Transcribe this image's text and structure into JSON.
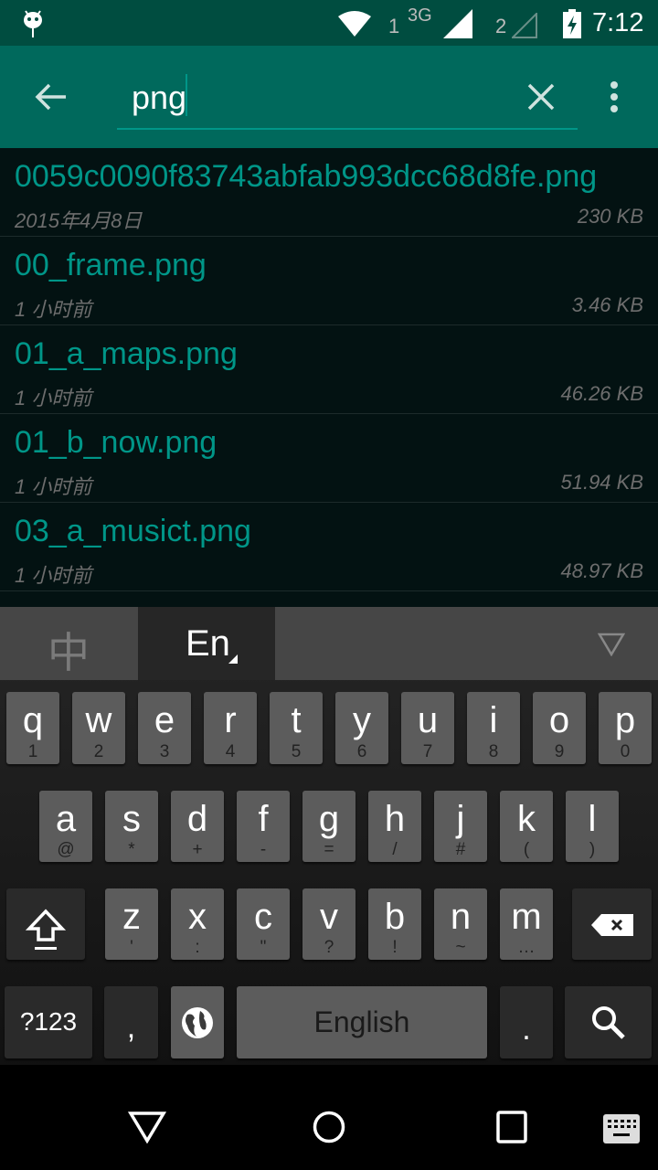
{
  "status_bar": {
    "time": "7:12",
    "sim1_label": "1",
    "network_type": "3G",
    "sim2_label": "2",
    "icons": [
      "android-icon",
      "wifi-icon",
      "signal-icon",
      "signal-empty-icon",
      "battery-charging-icon"
    ]
  },
  "search": {
    "query": "png",
    "back_icon": "arrow-left-icon",
    "clear_icon": "close-icon",
    "menu_icon": "more-vert-icon",
    "accent": "#009688"
  },
  "files": [
    {
      "name": "0059c0090f83743abfab993dcc68d8fe.png",
      "date": "2015年4月8日",
      "size": "230 KB"
    },
    {
      "name": "00_frame.png",
      "date": "1 小时前",
      "size": "3.46 KB"
    },
    {
      "name": "01_a_maps.png",
      "date": "1 小时前",
      "size": "46.26 KB"
    },
    {
      "name": "01_b_now.png",
      "date": "1 小时前",
      "size": "51.94 KB"
    },
    {
      "name": "03_a_musict.png",
      "date": "1 小时前",
      "size": "48.97 KB"
    }
  ],
  "keyboard": {
    "lang_tabs": {
      "chinese": "中",
      "english": "En"
    },
    "row1": [
      {
        "k": "q",
        "s": "1"
      },
      {
        "k": "w",
        "s": "2"
      },
      {
        "k": "e",
        "s": "3"
      },
      {
        "k": "r",
        "s": "4"
      },
      {
        "k": "t",
        "s": "5"
      },
      {
        "k": "y",
        "s": "6"
      },
      {
        "k": "u",
        "s": "7"
      },
      {
        "k": "i",
        "s": "8"
      },
      {
        "k": "o",
        "s": "9"
      },
      {
        "k": "p",
        "s": "0"
      }
    ],
    "row2": [
      {
        "k": "a",
        "s": "@"
      },
      {
        "k": "s",
        "s": "*"
      },
      {
        "k": "d",
        "s": "+"
      },
      {
        "k": "f",
        "s": "-"
      },
      {
        "k": "g",
        "s": "="
      },
      {
        "k": "h",
        "s": "/"
      },
      {
        "k": "j",
        "s": "#"
      },
      {
        "k": "k",
        "s": "("
      },
      {
        "k": "l",
        "s": ")"
      }
    ],
    "row3": [
      {
        "k": "z",
        "s": "'"
      },
      {
        "k": "x",
        "s": ":"
      },
      {
        "k": "c",
        "s": "\""
      },
      {
        "k": "v",
        "s": "?"
      },
      {
        "k": "b",
        "s": "!"
      },
      {
        "k": "n",
        "s": "~"
      },
      {
        "k": "m",
        "s": "…"
      }
    ],
    "symbols_label": "?123",
    "comma": ",",
    "space_label": "English",
    "period": "."
  }
}
